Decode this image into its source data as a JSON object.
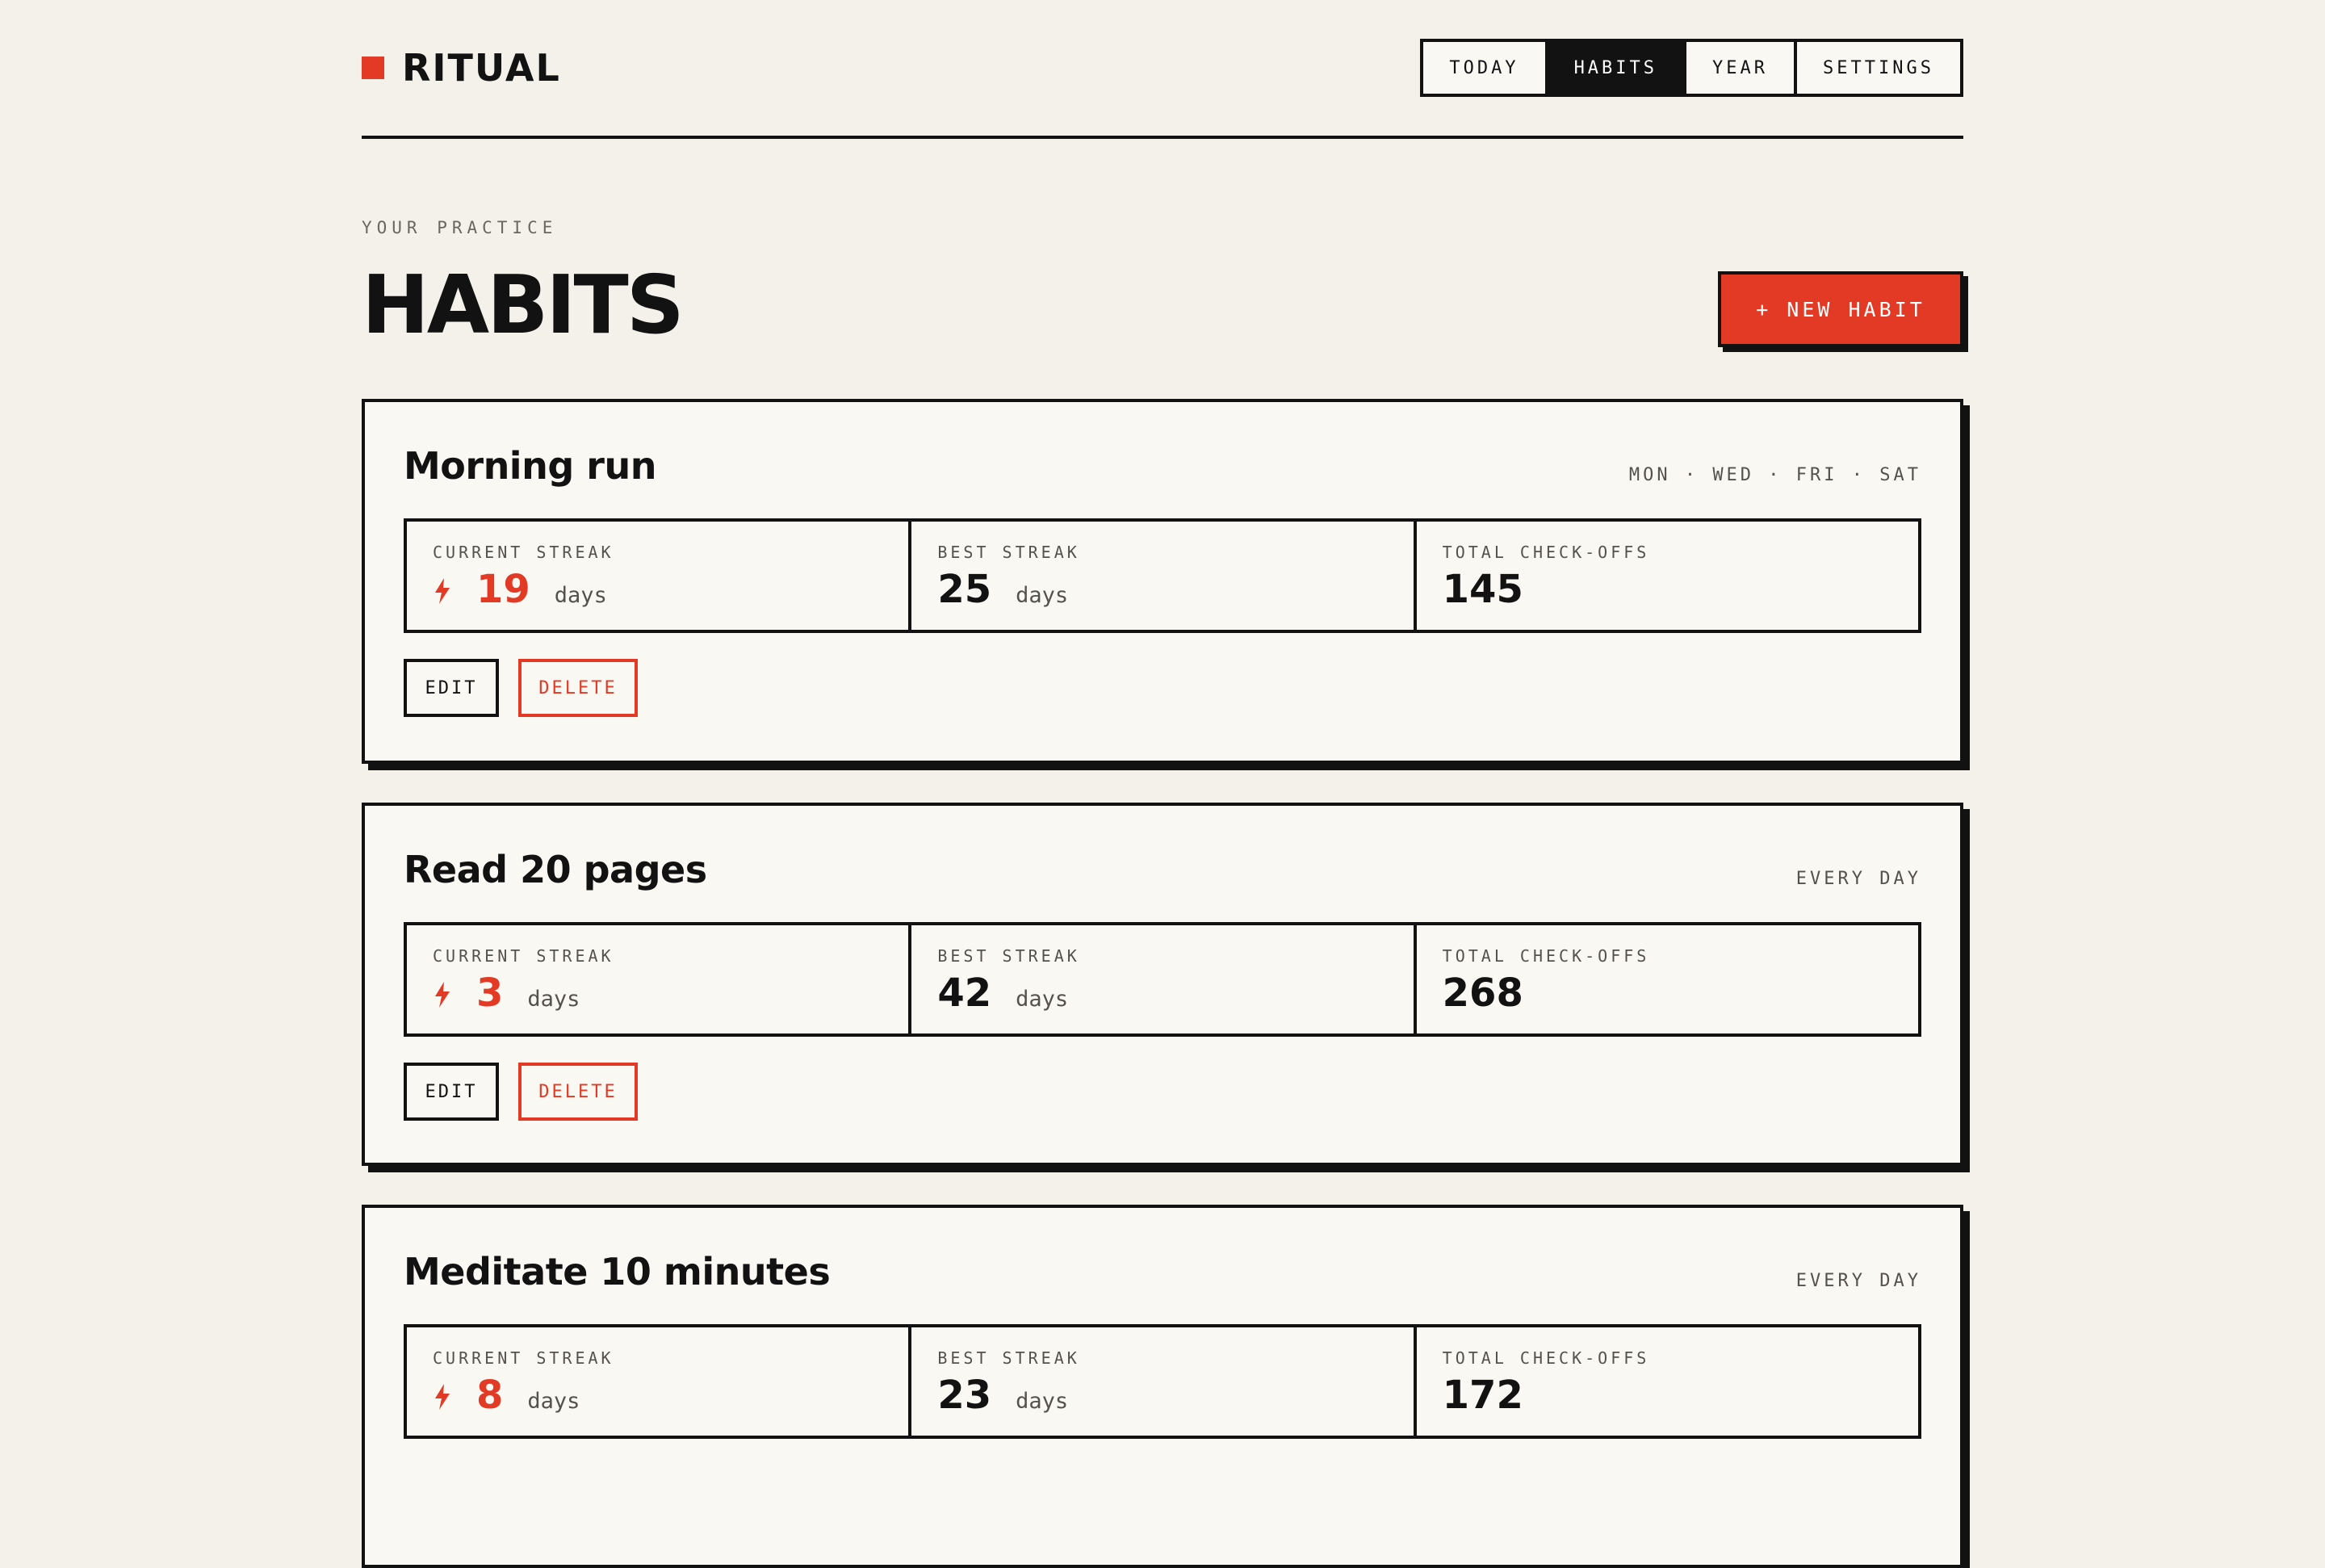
{
  "app": {
    "name": "RITUAL",
    "accent": "#e23a25"
  },
  "nav": {
    "items": [
      {
        "label": "TODAY",
        "active": false
      },
      {
        "label": "HABITS",
        "active": true
      },
      {
        "label": "YEAR",
        "active": false
      },
      {
        "label": "SETTINGS",
        "active": false
      }
    ]
  },
  "main": {
    "eyebrow": "YOUR PRACTICE",
    "title": "HABITS",
    "new_button": "+ NEW HABIT"
  },
  "labels": {
    "current_streak": "CURRENT STREAK",
    "best_streak": "BEST STREAK",
    "total": "TOTAL CHECK-OFFS",
    "unit": "days",
    "edit": "EDIT",
    "delete": "DELETE"
  },
  "habits": [
    {
      "name": "Morning run",
      "schedule": "MON · WED · FRI · SAT",
      "current": "19",
      "best": "25",
      "total": "145"
    },
    {
      "name": "Read 20 pages",
      "schedule": "EVERY DAY",
      "current": "3",
      "best": "42",
      "total": "268"
    },
    {
      "name": "Meditate 10 minutes",
      "schedule": "EVERY DAY",
      "current": "8",
      "best": "23",
      "total": "172"
    }
  ]
}
